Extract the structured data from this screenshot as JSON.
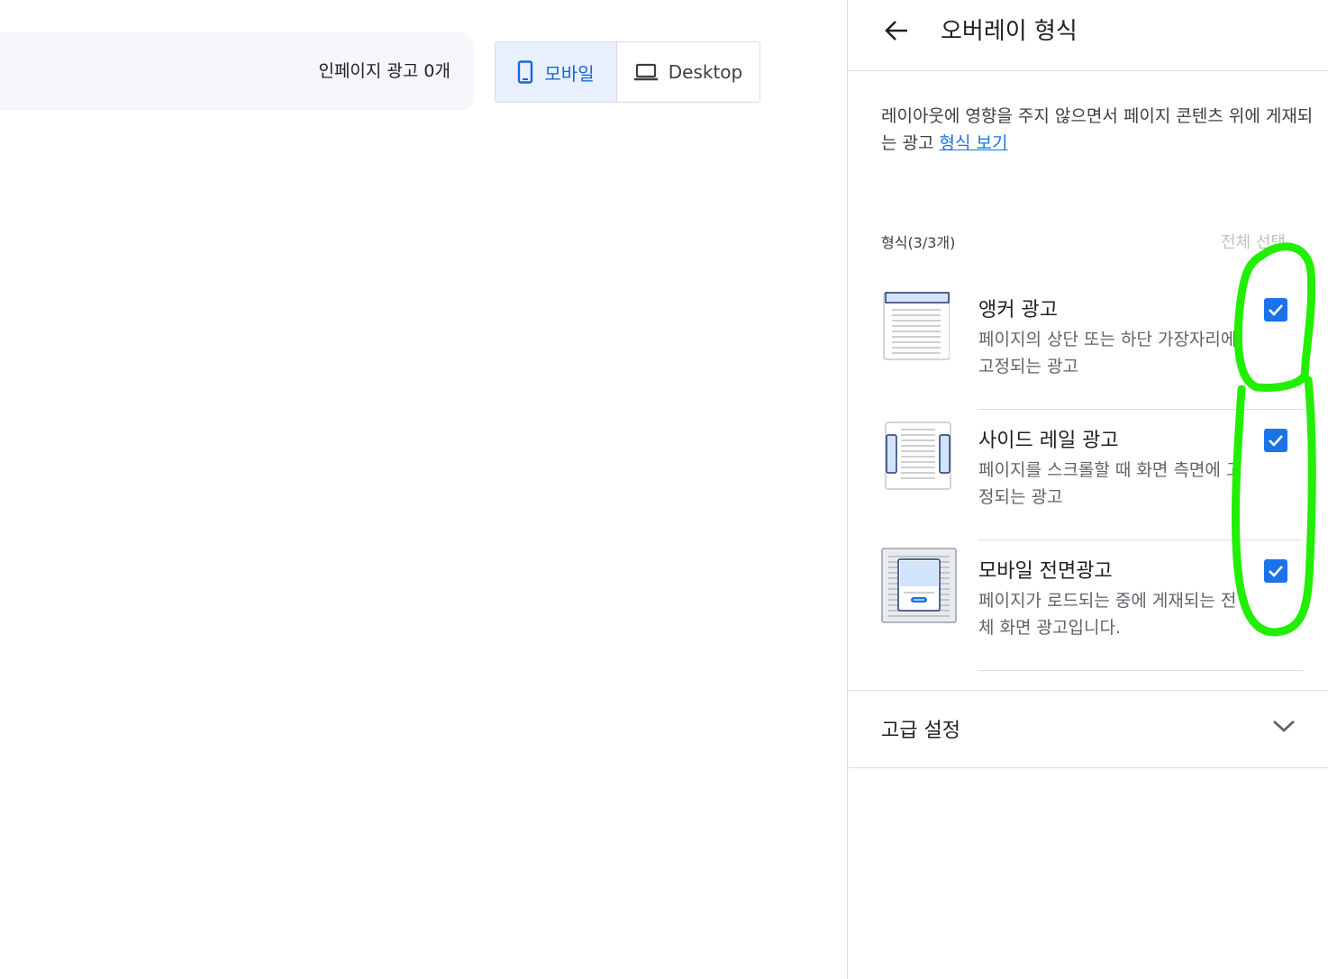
{
  "summary": {
    "text": "인페이지 광고 0개"
  },
  "device_toggle": {
    "options": [
      {
        "label": "모바일",
        "icon": "smartphone-icon",
        "selected": true
      },
      {
        "label": "Desktop",
        "icon": "laptop-icon",
        "selected": false
      }
    ]
  },
  "panel": {
    "title": "오버레이 형식",
    "description": "레이아웃에 영향을 주지 않으면서 페이지 콘텐츠 위에 게재되는 광고",
    "description_link": "형식 보기",
    "formats_count": "형식(3/3개)",
    "select_all": "전체 선택",
    "formats": [
      {
        "title": "앵커 광고",
        "description": "페이지의 상단 또는 하단 가장자리에 고정되는 광고",
        "checked": true,
        "icon": "anchor-ad-icon"
      },
      {
        "title": "사이드 레일 광고",
        "description": "페이지를 스크롤할 때 화면 측면에 고정되는 광고",
        "checked": true,
        "icon": "side-rail-ad-icon"
      },
      {
        "title": "모바일 전면광고",
        "description": "페이지가 로드되는 중에 게재되는 전체 화면 광고입니다.",
        "checked": true,
        "icon": "vignette-ad-icon"
      }
    ],
    "advanced_label": "고급 설정"
  },
  "colors": {
    "accent": "#1a73e8",
    "annotation": "#22ee00",
    "selected_bg": "#e8f0fe"
  }
}
